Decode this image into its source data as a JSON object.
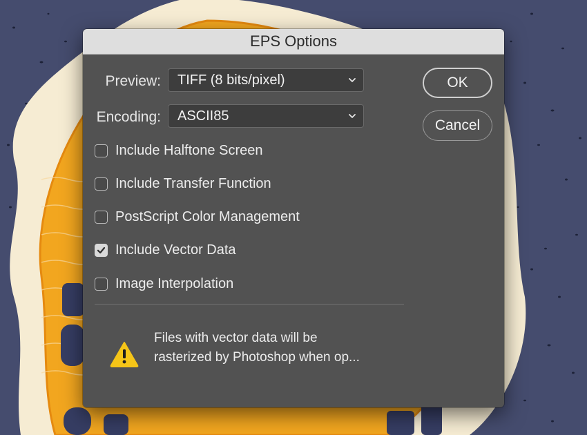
{
  "dialog": {
    "title": "EPS Options",
    "preview": {
      "label": "Preview:",
      "value": "TIFF  (8 bits/pixel)"
    },
    "encoding": {
      "label": "Encoding:",
      "value": "ASCII85"
    },
    "buttons": {
      "ok": "OK",
      "cancel": "Cancel"
    },
    "options": [
      {
        "label": "Include Halftone Screen",
        "checked": false
      },
      {
        "label": "Include Transfer Function",
        "checked": false
      },
      {
        "label": "PostScript Color Management",
        "checked": false
      },
      {
        "label": "Include Vector Data",
        "checked": true
      },
      {
        "label": "Image Interpolation",
        "checked": false
      }
    ],
    "warning": {
      "line1": "Files with vector data will be",
      "line2": "rasterized by Photoshop when op..."
    }
  },
  "colors": {
    "backdrop": "#454c6e",
    "badge_fill": "#f2a61f",
    "badge_cream": "#f6ecd3",
    "dialog_bg": "#525252",
    "warning_yellow": "#f5c518"
  },
  "icons": [
    "chevron-down-icon",
    "checkmark-icon",
    "warning-icon"
  ]
}
